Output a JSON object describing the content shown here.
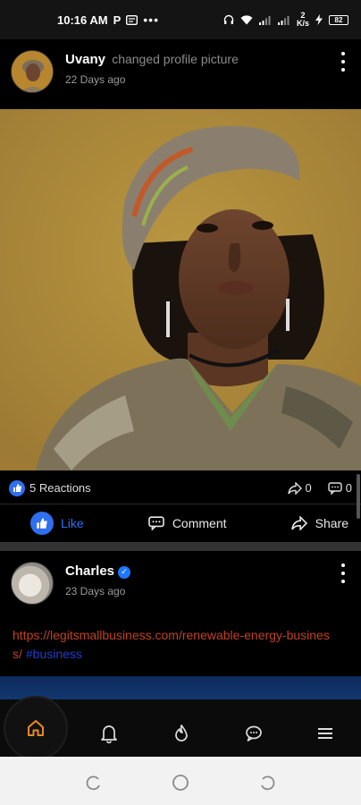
{
  "status_bar": {
    "time": "10:16 AM",
    "p_badge": "P",
    "dots": "•••",
    "net_speed": "2",
    "net_unit": "K/s",
    "battery": "82"
  },
  "post1": {
    "author": "Uvany",
    "action": "changed profile picture",
    "time": "22 Days ago",
    "reactions": "5 Reactions",
    "shares_count": "0",
    "comments_count": "0",
    "like_label": "Like",
    "comment_label": "Comment",
    "share_label": "Share"
  },
  "post2": {
    "author": "Charles",
    "verified_mark": "✓",
    "time": "23 Days ago",
    "url": "https://legitsmallbusiness.com/renewable-energy-business/",
    "hashtag": "#business"
  },
  "colors": {
    "accent_blue": "#2f6ff0",
    "link_orange": "#c0421f",
    "hashtag_blue": "#1f3fc6",
    "home_active": "#e98a1d"
  },
  "icons": {
    "nav": [
      "home-icon",
      "bell-icon",
      "flame-icon",
      "chat-bubble-icon",
      "menu-icon"
    ],
    "system": [
      "recents-icon",
      "home-circle-icon",
      "back-icon"
    ]
  }
}
